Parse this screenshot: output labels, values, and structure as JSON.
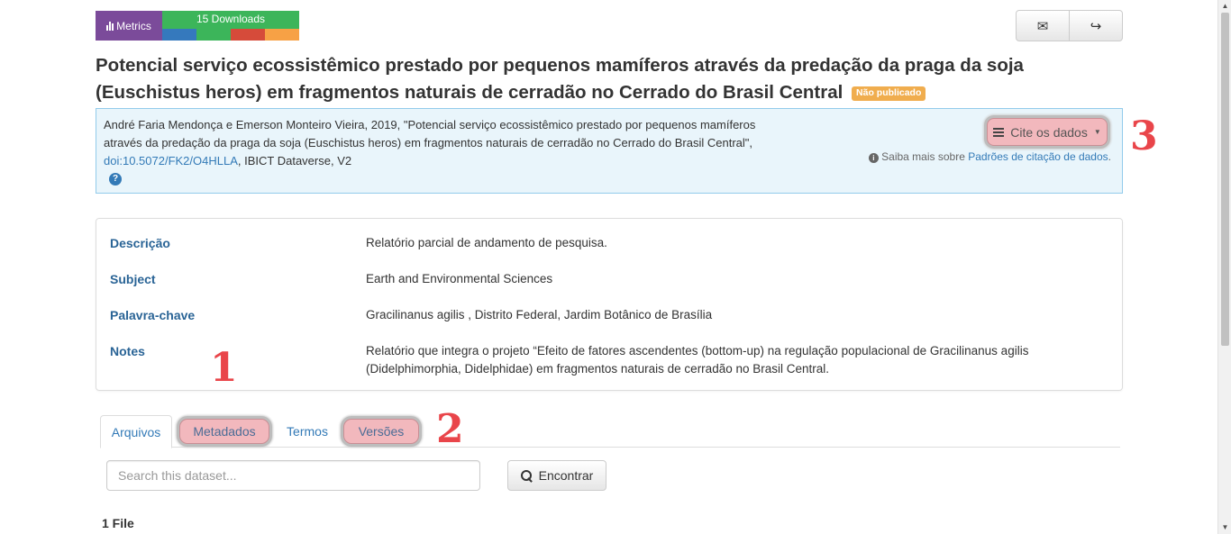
{
  "metrics": {
    "label": "Metrics",
    "downloads": "15 Downloads",
    "segment_colors": [
      "#3579bd",
      "#3cb55a",
      "#d64b3a",
      "#f7a145"
    ]
  },
  "header_buttons": {
    "email_icon": "envelope-icon",
    "share_icon": "share-icon"
  },
  "title": {
    "line1": "Potencial serviço ecossistêmico prestado por pequenos mamíferos através da predação da praga da soja",
    "line2": "(Euschistus heros) em fragmentos naturais de cerradão no Cerrado do Brasil Central",
    "status_badge": "Não publicado"
  },
  "citation": {
    "text_before_doi": "André Faria Mendonça e Emerson Monteiro Vieira, 2019, \"Potencial serviço ecossistêmico prestado por pequenos mamíferos através da predação da praga da soja (Euschistus heros) em fragmentos naturais de cerradão no Cerrado do Brasil Central\", ",
    "doi": "doi:10.5072/FK2/O4HLLA",
    "text_after_doi": ", IBICT Dataverse, V2",
    "help_icon": "?",
    "cite_button": "Cite os dados",
    "note_prefix": "Saiba mais sobre ",
    "note_link": "Padrões de citação de dados",
    "note_suffix": "."
  },
  "metadata": [
    {
      "label": "Descrição",
      "value": "Relatório parcial de andamento de pesquisa."
    },
    {
      "label": "Subject",
      "value": "Earth and Environmental Sciences"
    },
    {
      "label": "Palavra-chave",
      "value": "Gracilinanus agilis , Distrito Federal, Jardim Botânico de Brasília"
    },
    {
      "label": "Notes",
      "value": "Relatório que integra o projeto “Efeito de fatores ascendentes (bottom-up) na regulação populacional de Gracilinanus agilis (Didelphimorphia, Didelphidae) em fragmentos naturais de cerradão no Brasil Central."
    }
  ],
  "tabs": [
    "Arquivos",
    "Metadados",
    "Termos",
    "Versões"
  ],
  "search": {
    "placeholder": "Search this dataset...",
    "button": "Encontrar"
  },
  "file_count": "1 File",
  "annotations": [
    "1",
    "2",
    "3"
  ],
  "highlight_color": "#f2b8bd",
  "annotation_color": "#e9454a"
}
